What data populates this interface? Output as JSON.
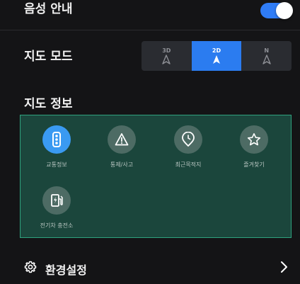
{
  "voice_guide": {
    "label": "음성 안내",
    "enabled": true,
    "accent_color": "#2f7cf6"
  },
  "map_mode": {
    "label": "지도 모드",
    "options": [
      {
        "label": "3D",
        "icon": "navigation-arrow-icon",
        "selected": false
      },
      {
        "label": "2D",
        "icon": "navigation-arrow-icon",
        "selected": true
      },
      {
        "label": "N",
        "icon": "navigation-arrow-icon",
        "selected": false
      }
    ],
    "selected_color": "#2b7cf0"
  },
  "map_info": {
    "label": "지도 정보",
    "border_color": "#2fa27e",
    "items": [
      {
        "label": "교통정보",
        "icon": "traffic-light-icon",
        "selected": true
      },
      {
        "label": "통제/사고",
        "icon": "warning-triangle-icon",
        "selected": false
      },
      {
        "label": "최근목적지",
        "icon": "location-clock-icon",
        "selected": false
      },
      {
        "label": "즐겨찾기",
        "icon": "star-icon",
        "selected": false
      },
      {
        "label": "전기차 충전소",
        "icon": "ev-charger-icon",
        "selected": false
      }
    ]
  },
  "settings": {
    "label": "환경설정",
    "icon": "gear-icon",
    "chevron": "chevron-right-icon"
  }
}
